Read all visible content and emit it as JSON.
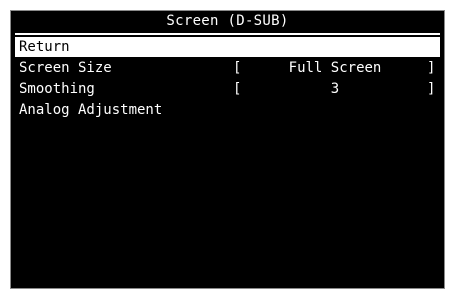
{
  "menu": {
    "title": "Screen (D-SUB)",
    "items": [
      {
        "label": "Return"
      },
      {
        "label": "Screen Size",
        "bracket_open": "[",
        "value": "Full Screen",
        "bracket_close": "]"
      },
      {
        "label": "Smoothing",
        "bracket_open": "[",
        "value": "3",
        "bracket_close": "]"
      },
      {
        "label": "Analog Adjustment"
      }
    ]
  },
  "colors": {
    "background": "#000000",
    "text": "#ffffff",
    "highlight": "#ffffff",
    "highlight_text": "#000000"
  }
}
